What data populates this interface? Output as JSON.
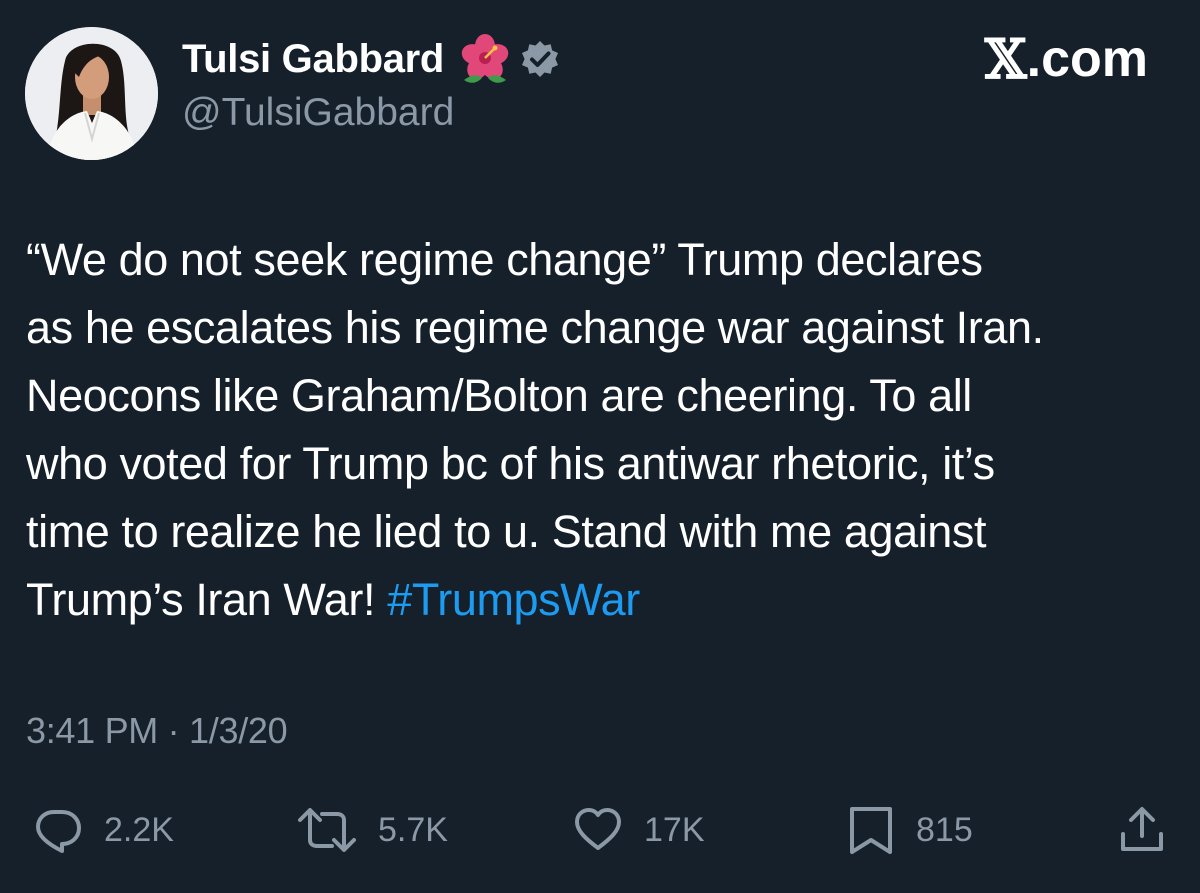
{
  "author": {
    "display_name": "Tulsi Gabbard",
    "handle": "@TulsiGabbard",
    "name_emoji_icon": "hibiscus-icon",
    "verified_icon": "verified-badge-icon",
    "verified_color": "#8b98a5"
  },
  "brand": {
    "mark": "𝕏",
    "suffix": ".com"
  },
  "tweet": {
    "text": "“We do not seek regime change” Trump declares\nas he escalates his regime change war against Iran.\nNeocons like Graham/Bolton are cheering. To all\nwho voted for Trump bc of his antiwar rhetoric, it’s\ntime to realize he lied to u. Stand with me against\nTrump’s Iran War! ",
    "hashtag": "#TrumpsWar",
    "timestamp": "3:41 PM · 1/3/20"
  },
  "actions": {
    "reply": {
      "icon": "reply-icon",
      "count": "2.2K"
    },
    "retweet": {
      "icon": "retweet-icon",
      "count": "5.7K"
    },
    "like": {
      "icon": "heart-icon",
      "count": "17K"
    },
    "bookmark": {
      "icon": "bookmark-icon",
      "count": "815"
    },
    "share": {
      "icon": "share-icon"
    }
  },
  "colors": {
    "background": "#15202b",
    "text": "#ffffff",
    "secondary_text": "#8b98a5",
    "link": "#1d9bf0"
  }
}
